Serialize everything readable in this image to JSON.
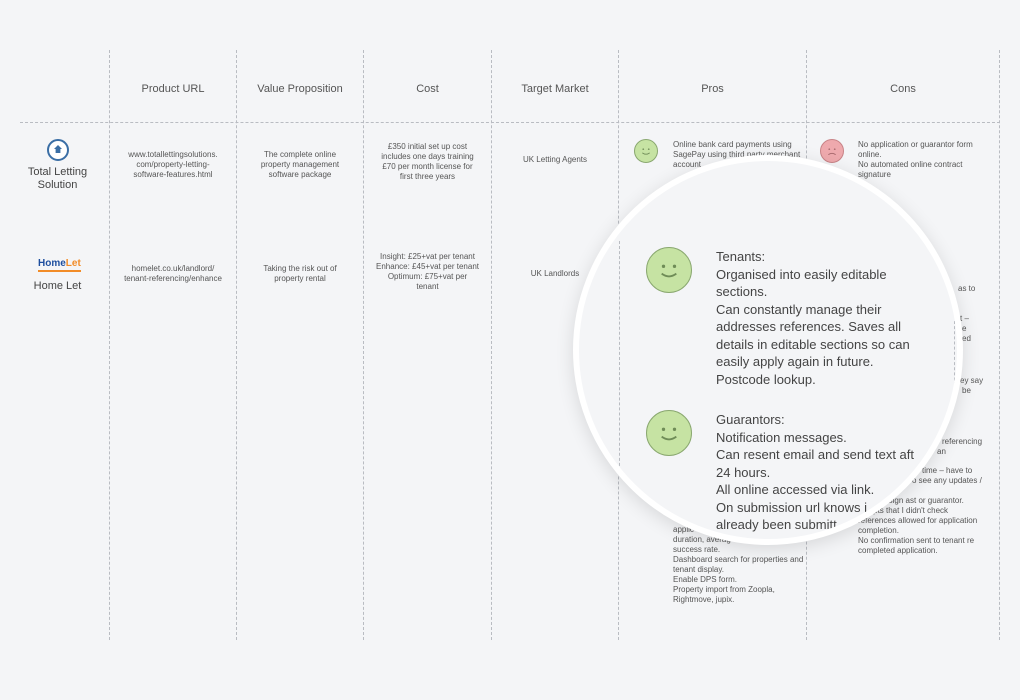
{
  "headers": {
    "product_url": "Product URL",
    "value_proposition": "Value Proposition",
    "cost": "Cost",
    "target_market": "Target Market",
    "pros": "Pros",
    "cons": "Cons"
  },
  "rows": [
    {
      "company": "Total Letting Solution",
      "company_line1": "Total Letting",
      "company_line2": "Solution",
      "url_lines": [
        "www.totallettingsolutions.",
        "com/property-letting-",
        "software-features.html"
      ],
      "value_lines": [
        "The complete online",
        "property management",
        "software package"
      ],
      "cost_lines": [
        "£350 initial set up cost",
        "includes one days training",
        "£70 per month license for",
        "first three years"
      ],
      "target_market": "UK Letting Agents",
      "pros_lines": [
        "Online bank card payments using",
        "SagePay using third party merchant",
        "account"
      ],
      "cons_lines": [
        "No application or guarantor form",
        "online.",
        "No automated online contract",
        "signature"
      ]
    },
    {
      "company": "Home Let",
      "logo_text_a": "Home",
      "logo_text_b": "Let",
      "url_lines": [
        "homelet.co.uk/landlord/",
        "tenant-referencing/enhance"
      ],
      "value_lines": [
        "Taking the risk out of",
        "property rental"
      ],
      "cost_lines": [
        "Insight: £25+vat per tenant",
        "Enhance: £45+vat per tenant",
        "Optimum: £75+vat per",
        "tenant"
      ],
      "target_market": "UK Landlords",
      "pros_bottom_lines": [
        "duration, averag",
        "success rate.",
        "Dashboard search for properties and",
        "tenant display.",
        "Enable DPS form.",
        "Property import from Zoopla,",
        "Rightmove, jupix."
      ],
      "pros_partial_lines": [
        "applic",
        "tenant display."
      ],
      "cons_fragments": [
        "as to",
        "t –",
        "e",
        "ed",
        "ey say",
        "be",
        "referencing",
        "an",
        "time – have to",
        "o see any updates /",
        "idn't sign ast or guarantor.",
        "empts that I didn't check",
        "references allowed for application",
        "completion.",
        "No confirmation sent to tenant re",
        "completed application."
      ]
    }
  ],
  "magnifier": {
    "tenants_lines": [
      "Tenants:",
      "Organised into easily editable",
      "sections.",
      "Can constantly manage their",
      "addresses references. Saves all",
      "details in editable sections so can",
      "easily apply again in future.",
      "Postcode lookup."
    ],
    "guarantors_lines": [
      "Guarantors:",
      "Notification messages.",
      "Can resent email and send text aft",
      "24 hours.",
      "All online accessed via link.",
      "On submission url knows i",
      "already been submitt"
    ]
  },
  "colors": {
    "happy": "#c6e3a3",
    "sad": "#eea9ad",
    "accent": "#1d4e9e",
    "brand_orange": "#f28c28"
  }
}
